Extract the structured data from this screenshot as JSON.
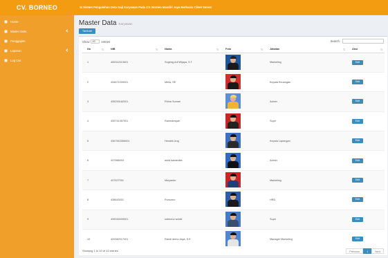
{
  "brand": "CV. BORNEO",
  "topbar": {
    "title": "SI Sistem Pengolahan Data Gaji Karyawan Pada CV. Borneo Mandiri Jaya Berbasis Client Server"
  },
  "sidebar": {
    "items": [
      {
        "label": "Home",
        "icon": "home-icon",
        "has_children": false
      },
      {
        "label": "Master Data",
        "icon": "list-icon",
        "has_children": true
      },
      {
        "label": "Penggajian",
        "icon": "money-icon",
        "has_children": false
      },
      {
        "label": "Laporan",
        "icon": "report-icon",
        "has_children": true
      },
      {
        "label": "Log Out",
        "icon": "logout-icon",
        "has_children": false
      }
    ]
  },
  "page": {
    "title": "Master Data",
    "subtitle": "Karyawan",
    "add_button": "Tambah"
  },
  "table_controls": {
    "show_label": "Show",
    "length_value": "10",
    "entries_label": "entries",
    "search_label": "Search:",
    "search_value": ""
  },
  "table": {
    "headers": [
      "No",
      "NIB",
      "Nama",
      "Foto",
      "Jabatan",
      "Aksi"
    ],
    "rows": [
      {
        "no": "1",
        "nib": "455312013001",
        "nama": "Sugeng Adi Wijaya, S.T",
        "jabatan": "Marketing",
        "aksi": "Edit",
        "photo_bg": "#1e56a0",
        "photo_body": "#1a1a1a",
        "photo_hair": "#222222"
      },
      {
        "no": "2",
        "nib": "434671009001",
        "nama": "Melia, SE",
        "jabatan": "Kepala Keuangan",
        "aksi": "Edit",
        "photo_bg": "#d32f2f",
        "photo_body": "#1a1a1a",
        "photo_hair": "#111111"
      },
      {
        "no": "3",
        "nib": "435293182001",
        "nama": "Rhina Sumari",
        "jabatan": "Admin",
        "aksi": "Edit",
        "photo_bg": "#5b8fd6",
        "photo_body": "#f2b233",
        "photo_hair": "#f5d36b"
      },
      {
        "no": "4",
        "nib": "435741357001",
        "nama": "Rahmansyah",
        "jabatan": "Supir",
        "aksi": "Edit",
        "photo_bg": "#c62828",
        "photo_body": "#222222",
        "photo_hair": "#111111"
      },
      {
        "no": "5",
        "nib": "4367643356001",
        "nama": "Hendrik Ang",
        "jabatan": "Kepala Lapangan",
        "aksi": "Edit",
        "photo_bg": "#3d6fc4",
        "photo_body": "#2b2b2b",
        "photo_hair": "#111111"
      },
      {
        "no": "6",
        "nib": "437566003",
        "nama": "aulia sanandita",
        "jabatan": "Admin",
        "aksi": "Edit",
        "photo_bg": "#2f6bc7",
        "photo_body": "#111111",
        "photo_hair": "#111111"
      },
      {
        "no": "7",
        "nib": "437627001",
        "nama": "Mulyanter",
        "jabatan": "Marketing",
        "aksi": "Edit",
        "photo_bg": "#c62828",
        "photo_body": "#1f3f7a",
        "photo_hair": "#111111"
      },
      {
        "no": "8",
        "nib": "438643001",
        "nama": "Purnomo",
        "jabatan": "HRD",
        "aksi": "Edit",
        "photo_bg": "#2c5fa8",
        "photo_body": "#1a1a1a",
        "photo_hair": "#111111"
      },
      {
        "no": "9",
        "nib": "439015009001",
        "nama": "subriono wolde",
        "jabatan": "Supir",
        "aksi": "Edit",
        "photo_bg": "#4579c9",
        "photo_body": "#3a4f6e",
        "photo_hair": "#111111"
      },
      {
        "no": "10",
        "nib": "420082017001",
        "nama": "Randi demo Jaya, S.E",
        "jabatan": "Manager Marketing",
        "aksi": "Edit",
        "photo_bg": "#4f86d0",
        "photo_body": "#e6e6e6",
        "photo_hair": "#111111"
      }
    ]
  },
  "footer": {
    "info": "Showing 1 to 10 of 10 entries",
    "previous": "Previous",
    "page": "1",
    "next": "Next"
  },
  "colors": {
    "brand_orange": "#f39c12",
    "sidebar_orange": "#f0a02a",
    "button_blue": "#3c8dbc"
  }
}
